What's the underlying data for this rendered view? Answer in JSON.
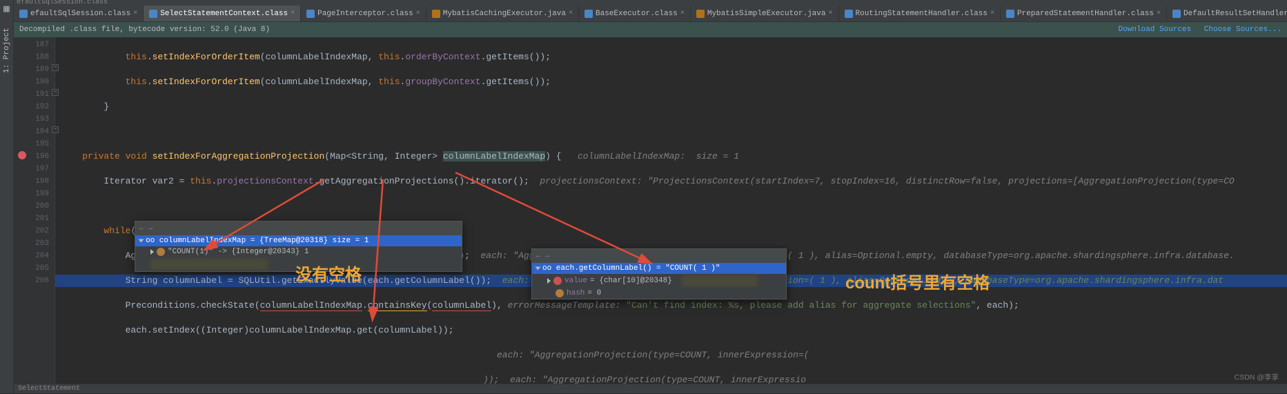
{
  "titlebar": "efaultSqlSession.class",
  "toolWindow": {
    "label": "1: Project"
  },
  "tabs": [
    {
      "label": "efaultSqlSession.class",
      "icon": "c",
      "active": false
    },
    {
      "label": "SelectStatementContext.class",
      "icon": "c",
      "active": true
    },
    {
      "label": "PageInterceptor.class",
      "icon": "c",
      "active": false
    },
    {
      "label": "MybatisCachingExecutor.java",
      "icon": "j",
      "active": false
    },
    {
      "label": "BaseExecutor.class",
      "icon": "c",
      "active": false
    },
    {
      "label": "MybatisSimpleExecutor.java",
      "icon": "j",
      "active": false
    },
    {
      "label": "RoutingStatementHandler.class",
      "icon": "c",
      "active": false
    },
    {
      "label": "PreparedStatementHandler.class",
      "icon": "c",
      "active": false
    },
    {
      "label": "DefaultResultSetHandler.class",
      "icon": "c",
      "active": false
    }
  ],
  "infobar": {
    "text": "Decompiled .class file, bytecode version: 52.0 (Java 8)",
    "link1": "Download Sources",
    "link2": "Choose Sources..."
  },
  "gutter": {
    "start": 187,
    "end": 206,
    "breakpointLine": 196
  },
  "code": {
    "l187": {
      "pre": "            ",
      "this": "this",
      "dot": ".",
      "fn": "setIndexForOrderItem",
      "open": "(columnLabelIndexMap, ",
      "this2": "this",
      "dot2": ".",
      "field": "orderByContext",
      "call": ".getItems());"
    },
    "l188": {
      "pre": "            ",
      "this": "this",
      "dot": ".",
      "fn": "setIndexForOrderItem",
      "open": "(columnLabelIndexMap, ",
      "this2": "this",
      "dot2": ".",
      "field": "groupByContext",
      "call": ".getItems());"
    },
    "l189": {
      "pre": "        }"
    },
    "l190": {
      "pre": ""
    },
    "l191": {
      "pre": "    ",
      "kw1": "private void ",
      "fn": "setIndexForAggregationProjection",
      "sig": "(Map<String, Integer> ",
      "param": "columnLabelIndexMap",
      "close": ") {   ",
      "cm": "columnLabelIndexMap:  size = 1"
    },
    "l192": {
      "pre": "        Iterator var2 = ",
      "this": "this",
      "dot": ".",
      "field": "projectionsContext",
      "call": ".getAggregationProjections().iterator();  ",
      "cm": "projectionsContext: \"ProjectionsContext(startIndex=7, stopIndex=16, distinctRow=false, projections=[AggregationProjection(type=CO"
    },
    "l193": {
      "pre": ""
    },
    "l194": {
      "pre": "        ",
      "kw": "while",
      "body": "(var2.hasNext()) {"
    },
    "l195": {
      "pre": "            AggregationProjection each = (AggregationProjection)var2.next();  ",
      "cm": "each: \"AggregationProjection(type=COUNT, innerExpression=( 1 ), alias=Optional.empty, databaseType=org.apache.shardingsphere.infra.database."
    },
    "l196": {
      "pre": "            String columnLabel = SQLUtil.getExactlyValue(",
      "hl": "each.getColumnLabel()",
      "post": ");  ",
      "cm": "each: \"AggregationProjection(type=COUNT, innerExpression=( 1 ), alias=Optional.empty, databaseType=org.apache.shardingsphere.infra.dat"
    },
    "l197": {
      "pre": "            Preconditions.checkState(",
      "u1": "columnLabelIndexMap",
      "dot": ".",
      "u2": "containsKey",
      "open": "(",
      "u3": "columnLabel",
      "close": "), ",
      "cmlbl": "errorMessageTemplate: ",
      "str": "\"Can't find index: %s, please add alias for aggregate selections\"",
      ", each);": "",
      "tail": ", each);"
    },
    "l198": {
      "pre": "            each.setIndex((Integer)columnLabelIndexMap.get(columnLabel));"
    },
    "l199_cm": "each: \"AggregationProjection(type=COUNT, innerExpression=(",
    "l200_cm": "));  each: \"AggregationProjection(type=COUNT, innerExpressio"
  },
  "popup1": {
    "head": "oo columnLabelIndexMap = {TreeMap@20318}  size = 1",
    "row1": "\"COUNT(1)\" -> {Integer@20343} 1"
  },
  "popup2": {
    "head": "oo each.getColumnLabel() = \"COUNT( 1 )\"",
    "row1label": "value",
    "row1val": " = {char[10]@20348}",
    "row2label": "hash",
    "row2val": " = 0"
  },
  "annotations": {
    "left": "没有空格",
    "right": "count括号里有空格"
  },
  "watermark": "CSDN @李享",
  "crumbs": "SelectStatement"
}
